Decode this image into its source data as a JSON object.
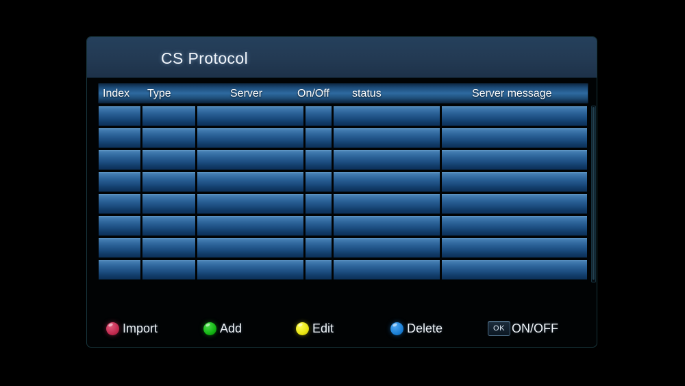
{
  "window": {
    "title": "CS Protocol"
  },
  "table": {
    "columns": [
      {
        "key": "index",
        "label": "Index"
      },
      {
        "key": "type",
        "label": "Type"
      },
      {
        "key": "server",
        "label": "Server"
      },
      {
        "key": "onoff",
        "label": "On/Off"
      },
      {
        "key": "status",
        "label": "status"
      },
      {
        "key": "server_message",
        "label": "Server message"
      }
    ],
    "rows": [],
    "empty_row_count": 8,
    "scrollbar": {
      "name": "vertical-scrollbar",
      "position": "right"
    }
  },
  "buttons": [
    {
      "name": "import-button",
      "label": "Import",
      "icon": "red-circle-icon",
      "color": "#c22a4f"
    },
    {
      "name": "add-button",
      "label": "Add",
      "icon": "green-circle-icon",
      "color": "#12b312"
    },
    {
      "name": "edit-button",
      "label": "Edit",
      "icon": "yellow-circle-icon",
      "color": "#e8e410"
    },
    {
      "name": "delete-button",
      "label": "Delete",
      "icon": "blue-circle-icon",
      "color": "#1a7fd4"
    },
    {
      "name": "onoff-button",
      "label": "ON/OFF",
      "icon": "ok-key-icon",
      "key_label": "OK"
    }
  ],
  "theme": {
    "background": "#000000",
    "panel_border": "#17353c",
    "titlebar": "#233a53",
    "header_accent": "#2e6aa0",
    "cell_top": "#4f87b8",
    "cell_bottom": "#0d3159",
    "text": "#ffffff"
  }
}
